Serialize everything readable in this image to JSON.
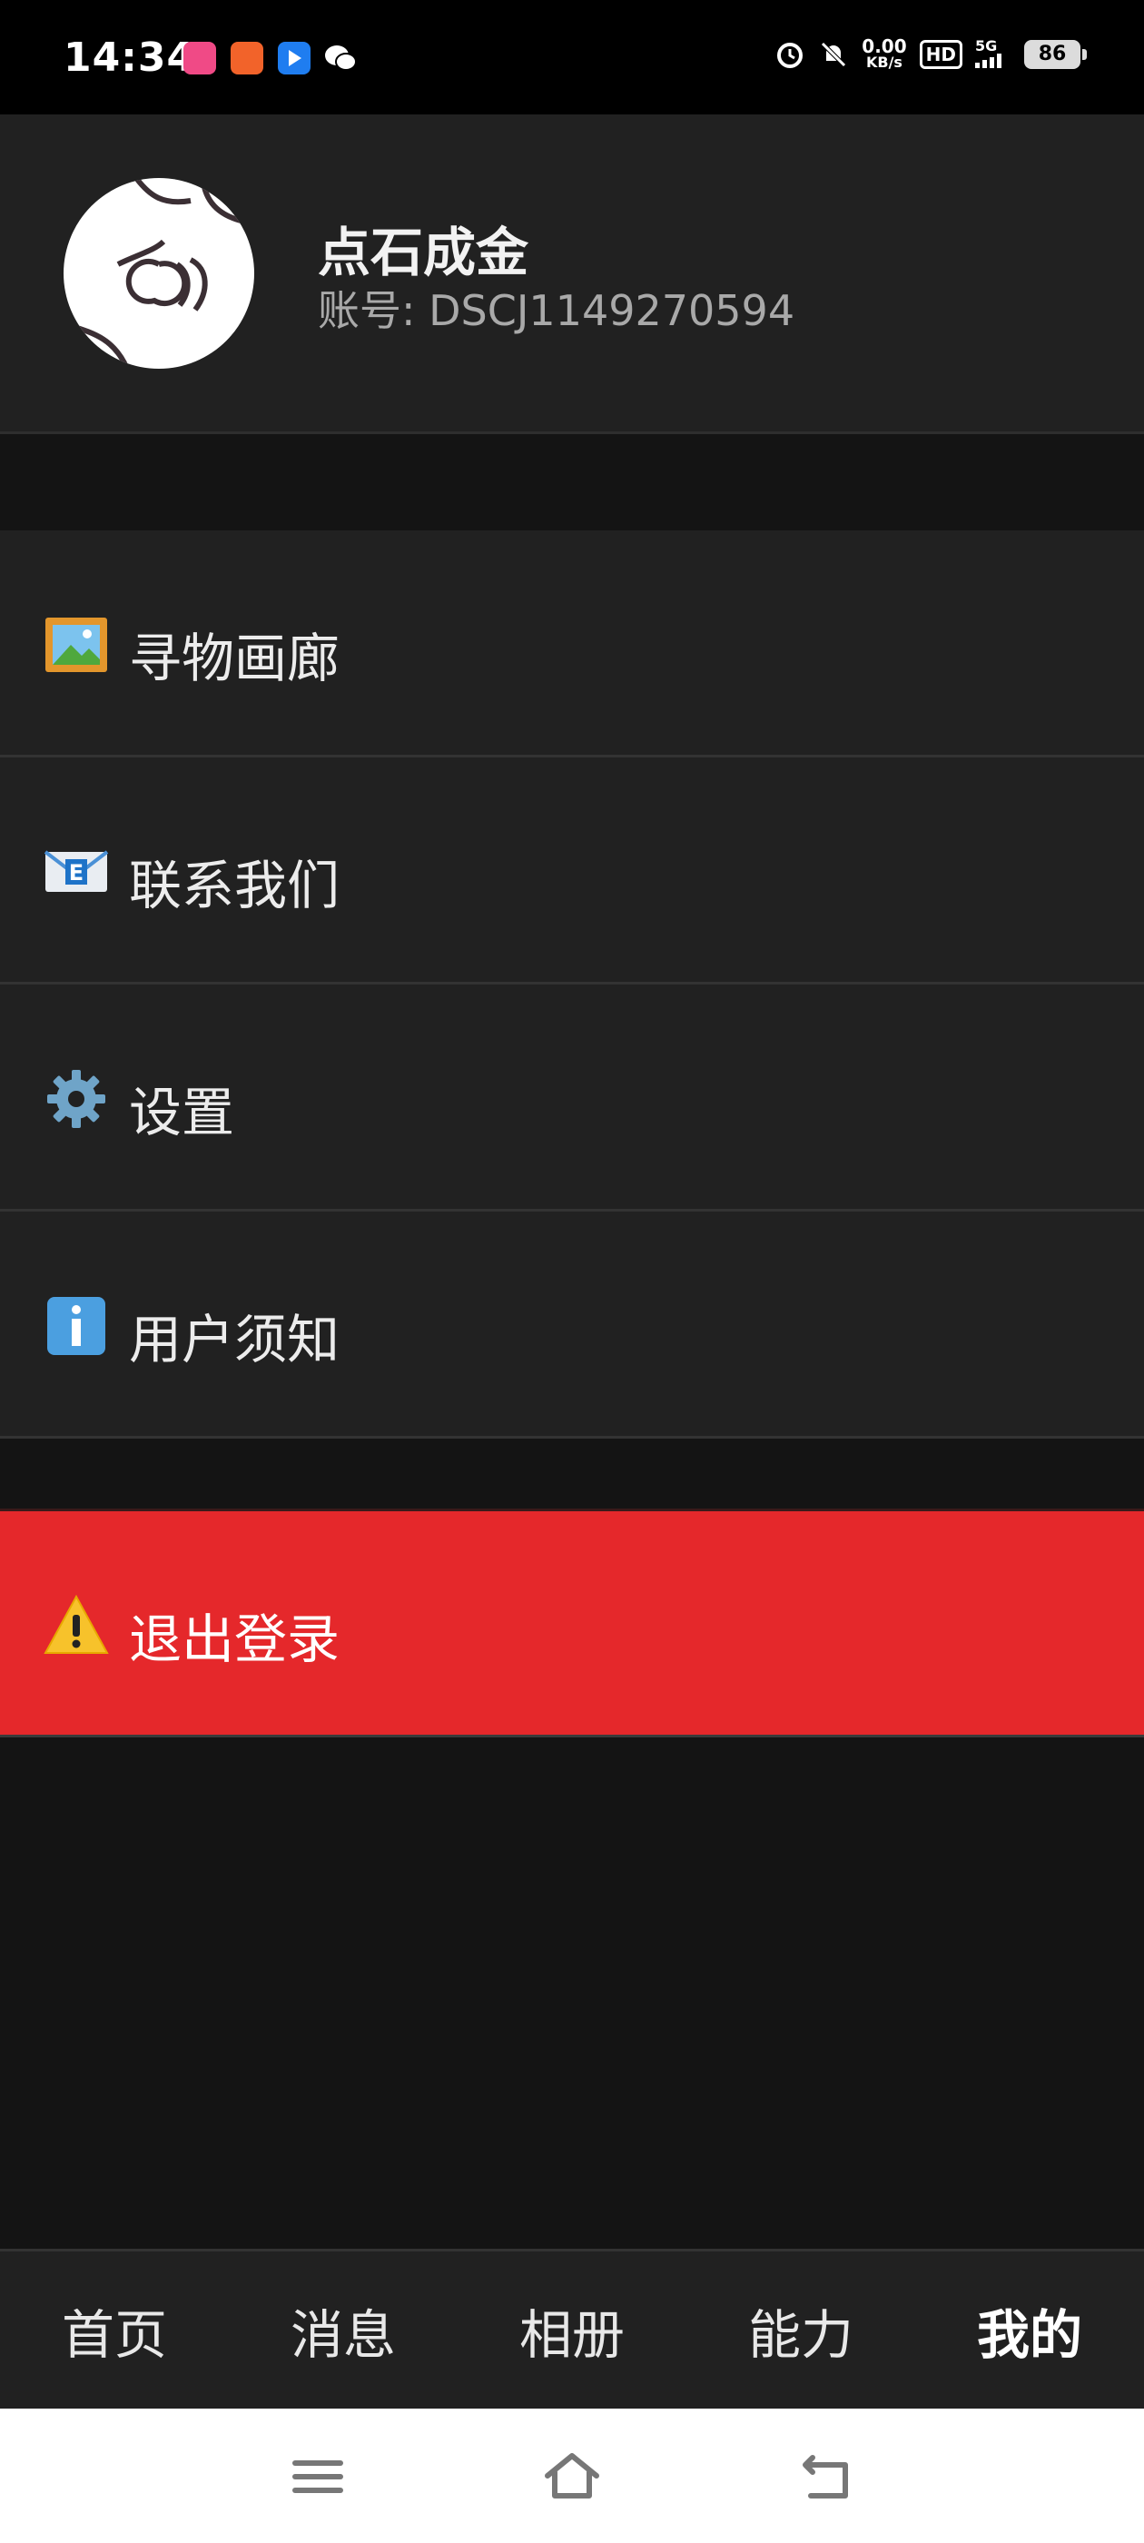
{
  "status_bar": {
    "time": "14:34",
    "net_speed_value": "0.00",
    "net_speed_unit": "KB/s",
    "hd_label": "HD",
    "signal_label": "5G",
    "battery": "86",
    "app_icons": [
      "qiyi-icon",
      "game-icon",
      "feishu-icon",
      "wechat-icon"
    ]
  },
  "profile": {
    "username": "点石成金",
    "account": "账号: DSCJ1149270594"
  },
  "menu": {
    "items": [
      {
        "icon": "framed-picture-icon",
        "label": "寻物画廊"
      },
      {
        "icon": "envelope-icon",
        "label": "联系我们"
      },
      {
        "icon": "gear-icon",
        "label": "设置"
      },
      {
        "icon": "info-icon",
        "label": "用户须知"
      }
    ],
    "logout": {
      "icon": "warning-icon",
      "label": "退出登录",
      "color": "#e5282b"
    }
  },
  "bottom_nav": {
    "tabs": [
      "首页",
      "消息",
      "相册",
      "能力",
      "我的"
    ],
    "active": "我的"
  },
  "system_nav": [
    "menu-icon",
    "home-icon",
    "back-icon"
  ]
}
